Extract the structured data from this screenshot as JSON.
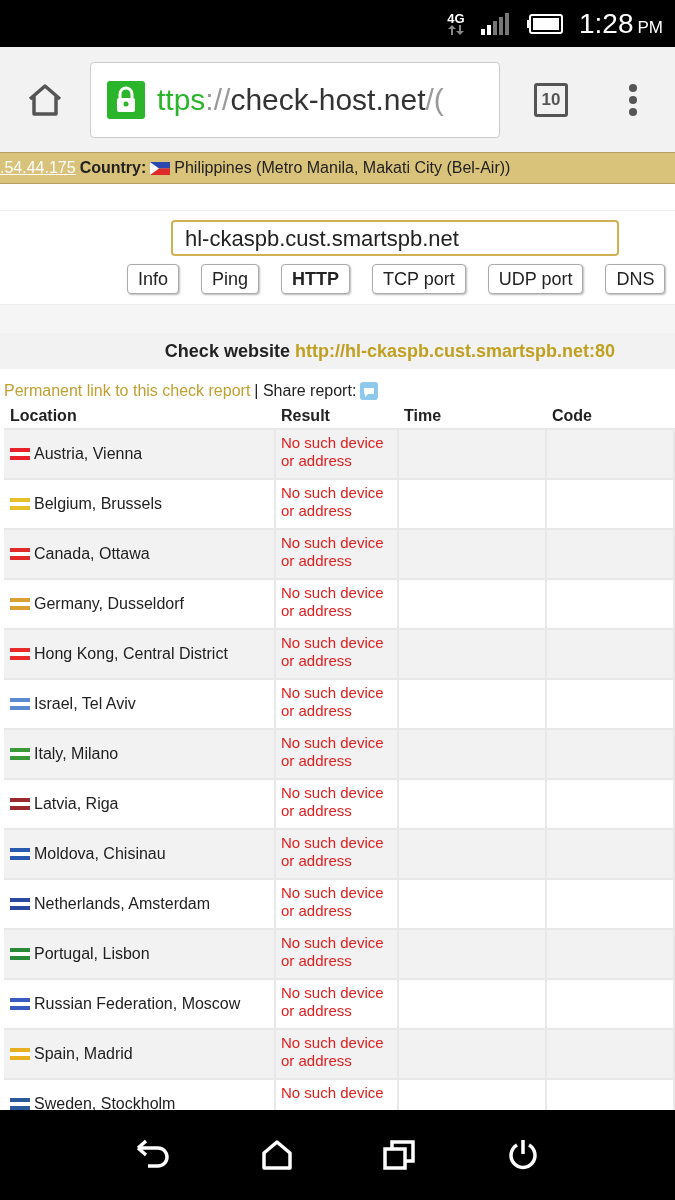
{
  "status_bar": {
    "network": "4G",
    "time": "1:28",
    "ampm": "PM"
  },
  "browser": {
    "url_scheme": "ttps",
    "url_sep": "://",
    "url_host": "check-host.net",
    "url_rest": "/(",
    "tabs_count": "10"
  },
  "banner": {
    "ip": ".54.44.175",
    "country_label": "Country:",
    "country": "Philippines (Metro Manila, Makati City (Bel-Air))"
  },
  "host_field": {
    "value": "hl-ckaspb.cust.smartspb.net"
  },
  "check_tabs": [
    {
      "label": "Info",
      "selected": false
    },
    {
      "label": "Ping",
      "selected": false
    },
    {
      "label": "HTTP",
      "selected": true
    },
    {
      "label": "TCP port",
      "selected": false
    },
    {
      "label": "UDP port",
      "selected": false
    },
    {
      "label": "DNS",
      "selected": false
    }
  ],
  "check_title": {
    "prefix": "Check website",
    "url": "http://hl-ckaspb.cust.smartspb.net:80"
  },
  "permalink": "Permanent link to this check report",
  "share_label": "| Share report:",
  "table": {
    "columns": [
      "Location",
      "Result",
      "Time",
      "Code"
    ],
    "rows": [
      {
        "location": "Austria, Vienna",
        "color": "#e8202a",
        "result": "No such device or address"
      },
      {
        "location": "Belgium, Brussels",
        "color": "#e8c02a",
        "result": "No such device or address"
      },
      {
        "location": "Canada, Ottawa",
        "color": "#e02a2a",
        "result": "No such device or address"
      },
      {
        "location": "Germany, Dusseldorf",
        "color": "#d8a030",
        "result": "No such device or address"
      },
      {
        "location": "Hong Kong, Central District",
        "color": "#e82a2a",
        "result": "No such device or address"
      },
      {
        "location": "Israel, Tel Aviv",
        "color": "#5a8ad0",
        "result": "No such device or address"
      },
      {
        "location": "Italy, Milano",
        "color": "#3a9a3a",
        "result": "No such device or address"
      },
      {
        "location": "Latvia, Riga",
        "color": "#9a2a30",
        "result": "No such device or address"
      },
      {
        "location": "Moldova, Chisinau",
        "color": "#2a5ab0",
        "result": "No such device or address"
      },
      {
        "location": "Netherlands, Amsterdam",
        "color": "#2a4aa0",
        "result": "No such device or address"
      },
      {
        "location": "Portugal, Lisbon",
        "color": "#2a8a3a",
        "result": "No such device or address"
      },
      {
        "location": "Russian Federation, Moscow",
        "color": "#3a5ac0",
        "result": "No such device or address"
      },
      {
        "location": "Spain, Madrid",
        "color": "#e8b020",
        "result": "No such device or address"
      },
      {
        "location": "Sweden, Stockholm",
        "color": "#2a5a9a",
        "result": "No such device"
      }
    ]
  }
}
